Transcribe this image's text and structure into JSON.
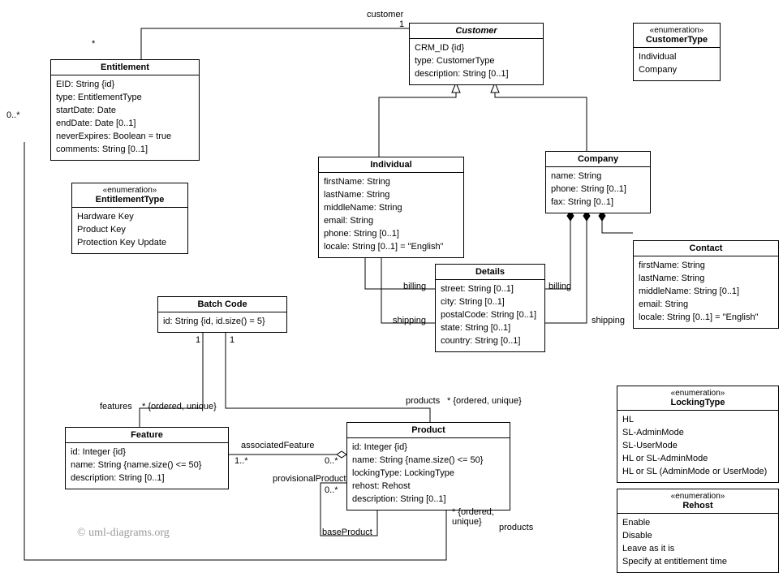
{
  "diagram": {
    "Customer": {
      "name": "Customer",
      "attrs": [
        "CRM_ID {id}",
        "type: CustomerType",
        "description: String [0..1]"
      ]
    },
    "CustomerType": {
      "stereotype": "«enumeration»",
      "name": "CustomerType",
      "attrs": [
        "Individual",
        "Company"
      ]
    },
    "Entitlement": {
      "name": "Entitlement",
      "attrs": [
        "EID: String {id}",
        "type: EntitlementType",
        "startDate: Date",
        "endDate: Date [0..1]",
        "neverExpires: Boolean = true",
        "comments: String [0..1]"
      ]
    },
    "EntitlementType": {
      "stereotype": "«enumeration»",
      "name": "EntitlementType",
      "attrs": [
        "Hardware Key",
        "Product Key",
        "Protection Key Update"
      ]
    },
    "Individual": {
      "name": "Individual",
      "attrs": [
        "firstName: String",
        "lastName: String",
        "middleName: String",
        "email: String",
        "phone: String [0..1]",
        "locale: String [0..1] = \"English\""
      ]
    },
    "Company": {
      "name": "Company",
      "attrs": [
        "name: String",
        "phone: String [0..1]",
        "fax: String [0..1]"
      ]
    },
    "Details": {
      "name": "Details",
      "attrs": [
        "street: String [0..1]",
        "city: String [0..1]",
        "postalCode: String [0..1]",
        "state: String [0..1]",
        "country: String [0..1]"
      ]
    },
    "Contact": {
      "name": "Contact",
      "attrs": [
        "firstName: String",
        "lastName: String",
        "middleName: String [0..1]",
        "email: String",
        "locale: String [0..1] = \"English\""
      ]
    },
    "BatchCode": {
      "name": "Batch Code",
      "attrs": [
        "id: String {id, id.size() = 5}"
      ]
    },
    "Feature": {
      "name": "Feature",
      "attrs": [
        "id: Integer {id}",
        "name: String {name.size() <= 50}",
        "description: String [0..1]"
      ]
    },
    "Product": {
      "name": "Product",
      "attrs": [
        "id: Integer {id}",
        "name: String {name.size() <= 50}",
        "lockingType: LockingType",
        "rehost: Rehost",
        "description: String [0..1]"
      ]
    },
    "LockingType": {
      "stereotype": "«enumeration»",
      "name": "LockingType",
      "attrs": [
        "HL",
        "SL-AdminMode",
        "SL-UserMode",
        "HL or SL-AdminMode",
        "HL or SL (AdminMode or UserMode)"
      ]
    },
    "Rehost": {
      "stereotype": "«enumeration»",
      "name": "Rehost",
      "attrs": [
        "Enable",
        "Disable",
        "Leave as it is",
        "Specify at entitlement time"
      ]
    }
  },
  "labels": {
    "customer": "customer",
    "one": "1",
    "star": "*",
    "zeroStar": "0..*",
    "billing": "billing",
    "shipping": "shipping",
    "features": "features",
    "orderedUnique": "* {ordered, unique}",
    "products": "products",
    "associatedFeature": "associatedFeature",
    "oneStar": "1..*",
    "zeroStarPlain": "0..*",
    "provisionalProduct": "provisionalProduct",
    "baseProduct": "baseProduct",
    "orderedUniqueStack": "* {ordered,\nunique}",
    "products2": "products"
  },
  "copyright": "© uml-diagrams.org"
}
